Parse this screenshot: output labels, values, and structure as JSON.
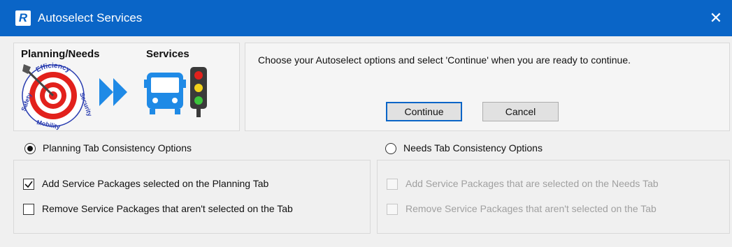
{
  "window": {
    "title": "Autoselect Services",
    "app_icon_letter": "R",
    "close_glyph": "✕",
    "titlebar_color": "#0a65c7"
  },
  "logo": {
    "left_heading": "Planning/Needs",
    "right_heading": "Services",
    "target_ring_text": [
      "Efficiency",
      "Security",
      "Safety",
      "Mobility"
    ],
    "icons": [
      "target-with-dart-icon",
      "double-arrow-icon",
      "bus-icon",
      "traffic-light-icon"
    ]
  },
  "message": {
    "text": "Choose your Autoselect options and select 'Continue' when you are ready to continue."
  },
  "buttons": {
    "continue_label": "Continue",
    "cancel_label": "Cancel"
  },
  "planning": {
    "option_label": "Planning Tab Consistency Options",
    "selected": true,
    "checkboxes": [
      {
        "label": "Add Service Packages selected on the Planning Tab",
        "checked": true,
        "enabled": true
      },
      {
        "label": "Remove Service Packages that aren't selected on the Tab",
        "checked": false,
        "enabled": true
      }
    ]
  },
  "needs": {
    "option_label": "Needs Tab Consistency Options",
    "selected": false,
    "checkboxes": [
      {
        "label": "Add Service Packages that are selected on the Needs Tab",
        "checked": false,
        "enabled": false
      },
      {
        "label": "Remove Service Packages that aren't selected on the Tab",
        "checked": false,
        "enabled": false
      }
    ]
  }
}
